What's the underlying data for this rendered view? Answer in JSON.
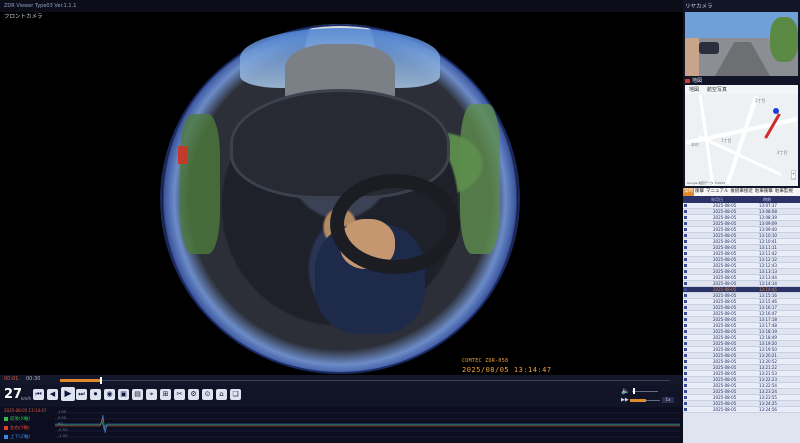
{
  "window": {
    "title": "ZDR Viewer  Type03 Ver.1.1.1"
  },
  "front": {
    "label": "フロントカメラ",
    "overlay_brand": "COMTEC  ZDR-058",
    "overlay_stamp": "2025/08/05   13:14:47"
  },
  "timeline": {
    "start": "00:01",
    "end": "00:30"
  },
  "controls": {
    "speed": "27",
    "speed_unit": "km/h",
    "buttons": [
      "⏮",
      "◀",
      "▶",
      "⏭",
      "⏺",
      "◉",
      "▣",
      "▤",
      "⌖",
      "⊞",
      "✂",
      "⚙",
      "⊙",
      "⌂",
      "❏"
    ],
    "volume_icon": "🔈",
    "rate_icon": "▶▶",
    "rate_value": "1x"
  },
  "graph": {
    "timestamp": "2025-08-05 13:14:47",
    "legend": [
      {
        "label": "前後(X軸)",
        "color": "#2ec34a"
      },
      {
        "label": "左右(Y軸)",
        "color": "#e0402c"
      },
      {
        "label": "上下(Z軸)",
        "color": "#3a8ae8"
      }
    ],
    "ticks": [
      "1.0G",
      "0.5G",
      "0G",
      "-0.5G",
      "-1.0G"
    ]
  },
  "rear": {
    "label": "リヤカメラ"
  },
  "map": {
    "header": "地図",
    "tabs": [
      "地図",
      "航空写真"
    ],
    "labels": [
      "2丁目",
      "1丁目",
      "4丁目",
      "本町"
    ],
    "credit": "Google  地図データ ©2025"
  },
  "list": {
    "tabs": [
      "常時",
      "衝撃",
      "マニュアル",
      "後続車接近",
      "駐車衝撃",
      "駐車監視"
    ],
    "columns": [
      "年月日",
      "時刻"
    ],
    "rows": [
      {
        "date": "2025-08-05",
        "time": "13:07:37"
      },
      {
        "date": "2025-08-05",
        "time": "13:08:08"
      },
      {
        "date": "2025-08-05",
        "time": "13:08:39"
      },
      {
        "date": "2025-08-05",
        "time": "13:09:09"
      },
      {
        "date": "2025-08-05",
        "time": "13:09:40"
      },
      {
        "date": "2025-08-05",
        "time": "13:10:10"
      },
      {
        "date": "2025-08-05",
        "time": "13:10:41"
      },
      {
        "date": "2025-08-05",
        "time": "13:11:11"
      },
      {
        "date": "2025-08-05",
        "time": "13:11:42"
      },
      {
        "date": "2025-08-05",
        "time": "13:12:12"
      },
      {
        "date": "2025-08-05",
        "time": "13:12:43"
      },
      {
        "date": "2025-08-05",
        "time": "13:13:13"
      },
      {
        "date": "2025-08-05",
        "time": "13:13:44"
      },
      {
        "date": "2025-08-05",
        "time": "13:14:14"
      },
      {
        "date": "2025-08-05",
        "time": "13:14:45",
        "selected": true
      },
      {
        "date": "2025-08-05",
        "time": "13:15:16"
      },
      {
        "date": "2025-08-05",
        "time": "13:15:46"
      },
      {
        "date": "2025-08-05",
        "time": "13:16:17"
      },
      {
        "date": "2025-08-05",
        "time": "13:16:47"
      },
      {
        "date": "2025-08-05",
        "time": "13:17:18"
      },
      {
        "date": "2025-08-05",
        "time": "13:17:48"
      },
      {
        "date": "2025-08-05",
        "time": "13:18:19"
      },
      {
        "date": "2025-08-05",
        "time": "13:18:49"
      },
      {
        "date": "2025-08-05",
        "time": "13:19:20"
      },
      {
        "date": "2025-08-05",
        "time": "13:19:50"
      },
      {
        "date": "2025-08-05",
        "time": "13:20:21"
      },
      {
        "date": "2025-08-05",
        "time": "13:20:52"
      },
      {
        "date": "2025-08-05",
        "time": "13:21:22"
      },
      {
        "date": "2025-08-05",
        "time": "13:21:53"
      },
      {
        "date": "2025-08-05",
        "time": "13:22:23"
      },
      {
        "date": "2025-08-05",
        "time": "13:22:54"
      },
      {
        "date": "2025-08-05",
        "time": "13:23:24"
      },
      {
        "date": "2025-08-05",
        "time": "13:23:55"
      },
      {
        "date": "2025-08-05",
        "time": "13:24:25"
      },
      {
        "date": "2025-08-05",
        "time": "13:24:56"
      }
    ]
  },
  "colors": {
    "accent": "#e08a2c",
    "panel": "#121428",
    "selected_row": "#2a3268"
  }
}
